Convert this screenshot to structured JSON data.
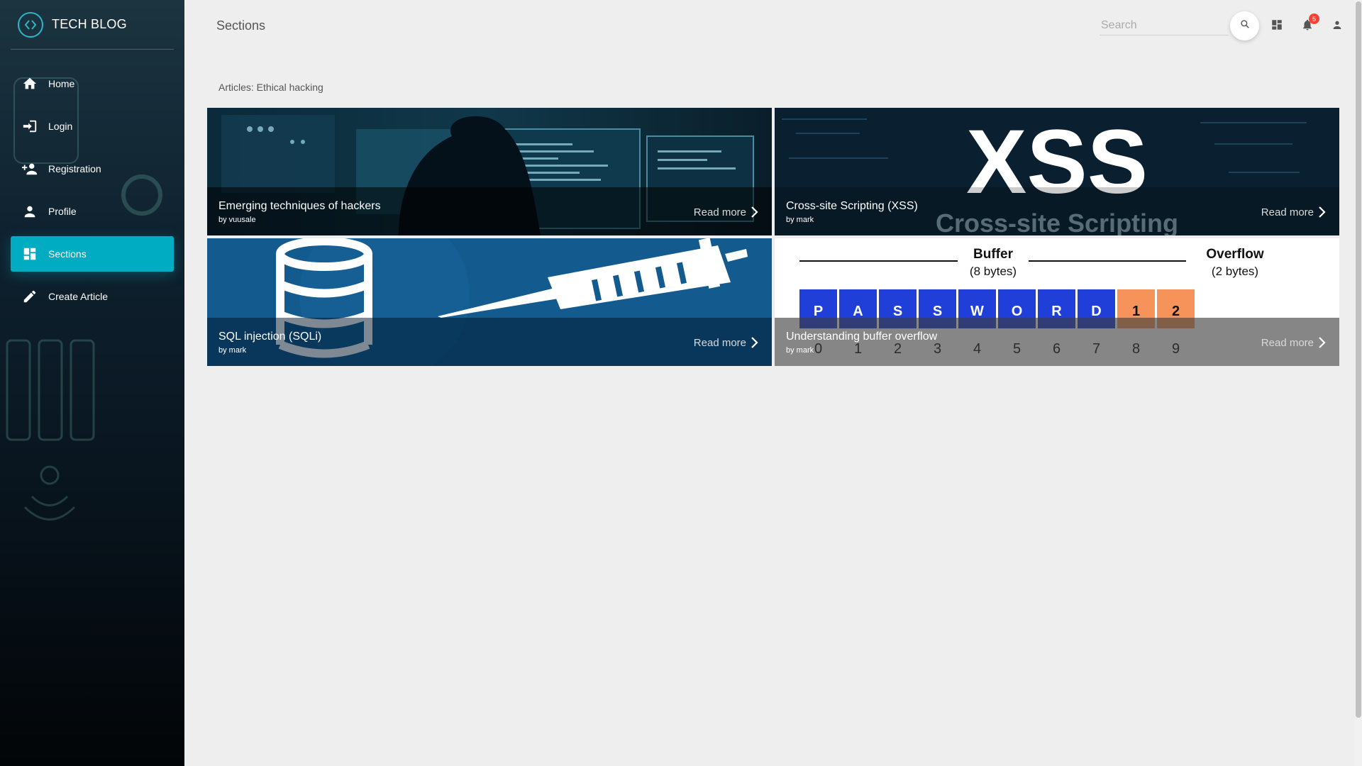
{
  "brand": {
    "title": "TECH BLOG",
    "logo_icon": "code-circle-icon"
  },
  "sidebar": {
    "items": [
      {
        "label": "Home",
        "icon": "home-icon"
      },
      {
        "label": "Login",
        "icon": "login-icon"
      },
      {
        "label": "Registration",
        "icon": "person-add-icon"
      },
      {
        "label": "Profile",
        "icon": "person-icon"
      },
      {
        "label": "Sections",
        "icon": "dashboard-icon",
        "active": true
      },
      {
        "label": "Create Article",
        "icon": "pencil-icon"
      }
    ]
  },
  "header": {
    "title": "Sections",
    "search_placeholder": "Search",
    "notifications_count": "5"
  },
  "main": {
    "section_label": "Articles: Ethical hacking",
    "articles": [
      {
        "title": "Emerging techniques of hackers",
        "author": "by vuusale",
        "read_more": "Read more"
      },
      {
        "title": "Cross-site Scripting (XSS)",
        "author": "by mark",
        "read_more": "Read more"
      },
      {
        "title": "SQL injection (SQLi)",
        "author": "by mark",
        "read_more": "Read more"
      },
      {
        "title": "Understanding buffer overflow",
        "author": "by mark",
        "read_more": "Read more"
      }
    ],
    "xss_image": {
      "big": "XSS",
      "sub": "Cross-site Scripting"
    },
    "buffer_image": {
      "buffer_label": "Buffer",
      "buffer_size": "(8 bytes)",
      "overflow_label": "Overflow",
      "overflow_size": "(2 bytes)",
      "cells": [
        "P",
        "A",
        "S",
        "S",
        "W",
        "O",
        "R",
        "D",
        "1",
        "2"
      ],
      "indices": [
        "0",
        "1",
        "2",
        "3",
        "4",
        "5",
        "6",
        "7",
        "8",
        "9"
      ]
    }
  },
  "colors": {
    "accent": "#00acc1",
    "badge": "#f44336",
    "buffer_cell": "#1f3fd8",
    "overflow_cell": "#f5935a"
  }
}
